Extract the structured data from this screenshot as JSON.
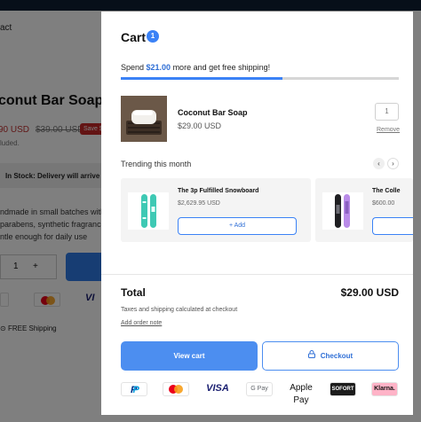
{
  "background_page": {
    "nav_fragment": "act",
    "title_fragment": "conut Bar Soap",
    "price_fragment": "90 USD",
    "compare_price": "$39.00 USD",
    "save_badge": "Save $",
    "included_fragment": "luded.",
    "stock_text": "In Stock: Delivery will arrive th",
    "description_lines": [
      "ndmade in small batches with",
      "parabens, synthetic fragranc",
      "ntle enough for daily use"
    ],
    "qty_value": "1",
    "qty_plus": "+",
    "free_shipping": "FREE Shipping"
  },
  "cart": {
    "title": "Cart",
    "count": "1",
    "shipping_prefix": "Spend ",
    "shipping_amount": "$21.00",
    "shipping_suffix": " more and get free shipping!",
    "progress_fraction": 0.58,
    "item": {
      "name": "Coconut Bar Soap",
      "price": "$29.00 USD",
      "quantity": "1",
      "remove_label": "Remove"
    },
    "trending": {
      "title": "Trending this month",
      "prev_icon": "chevron-left-icon",
      "next_icon": "chevron-right-icon",
      "products": [
        {
          "name": "The 3p Fulfilled Snowboard",
          "price": "$2,629.95 USD",
          "add_label": "+ Add"
        },
        {
          "name": "The Colle",
          "price": "$600.00",
          "add_label": ""
        }
      ]
    },
    "total_label": "Total",
    "total_value": "$29.00 USD",
    "tax_note": "Taxes and shipping calculated at checkout",
    "order_note_link": "Add order note",
    "view_cart_label": "View cart",
    "checkout_label": "Checkout",
    "payment_methods": [
      "PayPal",
      "Mastercard",
      "VISA",
      "G Pay",
      "Apple Pay",
      "SOFORT",
      "Klarna."
    ]
  },
  "colors": {
    "accent": "#3b82f6",
    "topbar": "#0f1f33",
    "sale": "#c62828"
  }
}
